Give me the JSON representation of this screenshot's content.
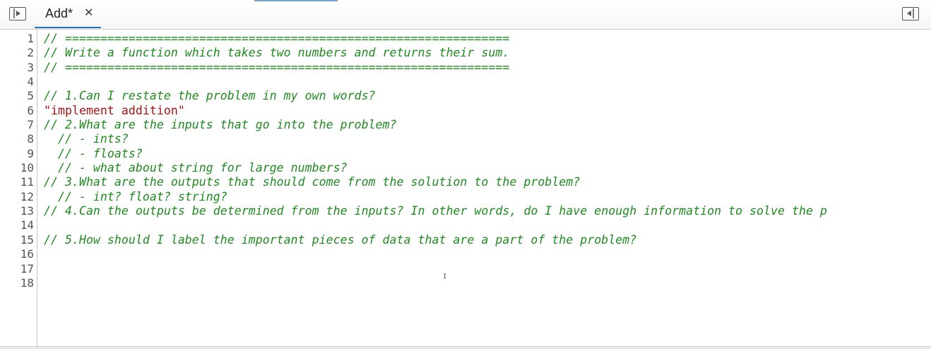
{
  "tabs": [
    {
      "label": "Add*",
      "close_glyph": "✕"
    }
  ],
  "icons": {
    "left_toggle": "sidebar-toggle-left-icon",
    "right_toggle": "sidebar-toggle-right-icon"
  },
  "colors": {
    "comment": "#1f8a1f",
    "string": "#a31515",
    "active_tab_underline": "#1e6ec8"
  },
  "editor": {
    "lines": [
      {
        "num": "1",
        "text": "// ===============================================================",
        "kind": "comment"
      },
      {
        "num": "2",
        "text": "// Write a function which takes two numbers and returns their sum.",
        "kind": "comment"
      },
      {
        "num": "3",
        "text": "// ===============================================================",
        "kind": "comment"
      },
      {
        "num": "4",
        "text": "",
        "kind": "plain"
      },
      {
        "num": "5",
        "text": "// 1.Can I restate the problem in my own words?",
        "kind": "comment"
      },
      {
        "num": "6",
        "text": "\"implement addition\"",
        "kind": "string"
      },
      {
        "num": "7",
        "text": "// 2.What are the inputs that go into the problem?",
        "kind": "comment"
      },
      {
        "num": "8",
        "text": "  // - ints?",
        "kind": "comment"
      },
      {
        "num": "9",
        "text": "  // - floats?",
        "kind": "comment"
      },
      {
        "num": "10",
        "text": "  // - what about string for large numbers?",
        "kind": "comment"
      },
      {
        "num": "11",
        "text": "// 3.What are the outputs that should come from the solution to the problem?",
        "kind": "comment"
      },
      {
        "num": "12",
        "text": "  // - int? float? string?",
        "kind": "comment"
      },
      {
        "num": "13",
        "text": "// 4.Can the outputs be determined from the inputs? In other words, do I have enough information to solve the p",
        "kind": "comment"
      },
      {
        "num": "14",
        "text": "",
        "kind": "plain"
      },
      {
        "num": "15",
        "text": "// 5.How should I label the important pieces of data that are a part of the problem?",
        "kind": "comment"
      },
      {
        "num": "16",
        "text": "",
        "kind": "plain"
      },
      {
        "num": "17",
        "text": "",
        "kind": "plain"
      },
      {
        "num": "18",
        "text": "",
        "kind": "plain"
      }
    ]
  }
}
